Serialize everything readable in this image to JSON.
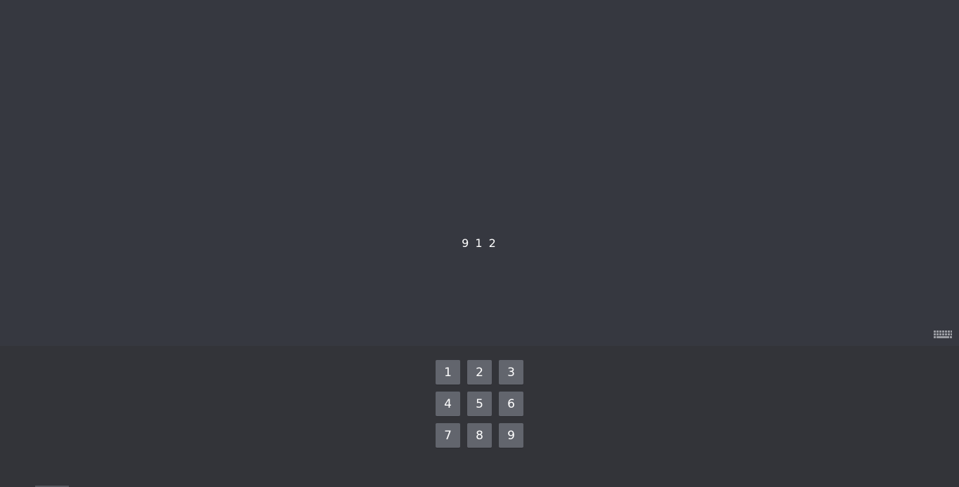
{
  "display": {
    "value": "9 1 2"
  },
  "keyboard_toggle": {
    "icon": "keyboard-icon"
  },
  "keypad": {
    "keys": [
      "1",
      "2",
      "3",
      "4",
      "5",
      "6",
      "7",
      "8",
      "9"
    ]
  },
  "colors": {
    "background": "#363840",
    "keypad_background": "#333439",
    "key_background": "#62656d",
    "text": "#ffffff"
  }
}
